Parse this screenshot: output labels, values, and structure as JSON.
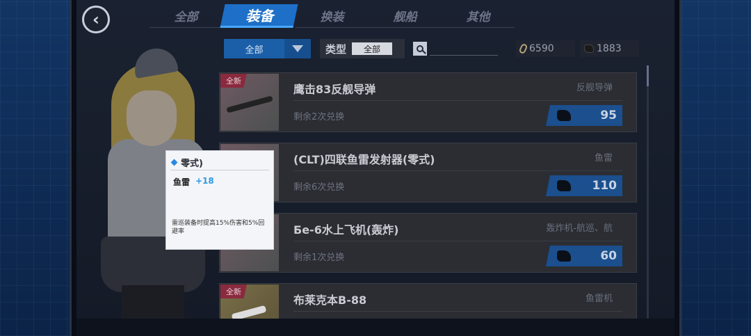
{
  "tabs": [
    {
      "label": "全部",
      "active": false
    },
    {
      "label": "装备",
      "active": true
    },
    {
      "label": "换装",
      "active": false
    },
    {
      "label": "舰船",
      "active": false
    },
    {
      "label": "其他",
      "active": false
    }
  ],
  "filter": {
    "dropdown_value": "全部",
    "type_label": "类型",
    "type_value": "全部"
  },
  "resources": {
    "paperclip": "6590",
    "ship_token": "1883"
  },
  "items": [
    {
      "badge": "全新",
      "name": "鹰击83反舰导弹",
      "category": "反舰导弹",
      "remaining": "剩余2次兑换",
      "price": "95",
      "thumb": "pink"
    },
    {
      "badge": "",
      "name": "(CLT)四联鱼雷发射器(零式)",
      "category": "鱼雷",
      "remaining": "剩余6次兑换",
      "price": "110",
      "thumb": "pink"
    },
    {
      "badge": "",
      "name": "Бе-6水上飞机(轰炸)",
      "category": "轰炸机-航巡、航",
      "remaining": "剩余1次兑换",
      "price": "60",
      "thumb": "pink"
    },
    {
      "badge": "全新",
      "name": "布莱克本B-88",
      "category": "鱼雷机",
      "remaining": "",
      "price": "",
      "thumb": "gold"
    }
  ],
  "tooltip": {
    "title": "零式)",
    "stat_name": "鱼雷",
    "stat_bonus": "+18",
    "description": "雷巡装备时提高15%伤害和5%回避率"
  },
  "colors": {
    "accent": "#1d6fc7",
    "bonus": "#2b9ae6",
    "badge": "#8a2a3e"
  }
}
